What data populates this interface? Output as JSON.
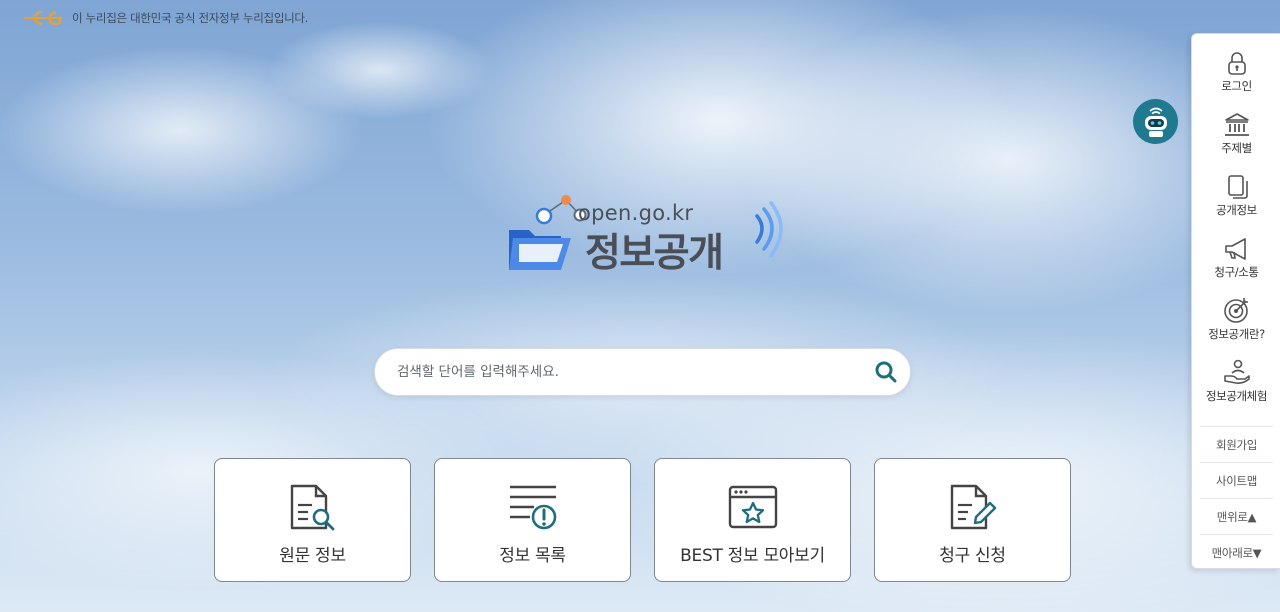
{
  "gov_banner": {
    "text": "이 누리집은 대한민국 공식 전자정부 누리집입니다."
  },
  "brand": {
    "url": "open.go.kr",
    "title": "정보공개"
  },
  "search": {
    "placeholder": "검색할 단어를 입력해주세요.",
    "icon": "search-icon"
  },
  "cards": [
    {
      "label": "원문 정보",
      "icon": "document-search-icon"
    },
    {
      "label": "정보 목록",
      "icon": "list-alert-icon"
    },
    {
      "label": "BEST 정보 모아보기",
      "icon": "window-star-icon"
    },
    {
      "label": "청구 신청",
      "icon": "document-edit-icon"
    }
  ],
  "quick_menu": {
    "items": [
      {
        "label": "로그인",
        "icon": "lock-icon"
      },
      {
        "label": "주제별",
        "icon": "building-icon"
      },
      {
        "label": "공개정보",
        "icon": "copy-icon"
      },
      {
        "label": "청구/소통",
        "icon": "megaphone-icon"
      },
      {
        "label": "정보공개란?",
        "icon": "target-icon"
      },
      {
        "label": "정보공개체험",
        "icon": "hand-person-icon"
      }
    ],
    "links": [
      {
        "label": "회원가입"
      },
      {
        "label": "사이트맵"
      },
      {
        "label": "맨위로▲"
      },
      {
        "label": "맨아래로▼"
      }
    ]
  },
  "colors": {
    "accent": "#1f6e7d",
    "card_border": "#7e8690",
    "brand_blue": "#2f6fd6",
    "brand_orange": "#f08a4b"
  }
}
